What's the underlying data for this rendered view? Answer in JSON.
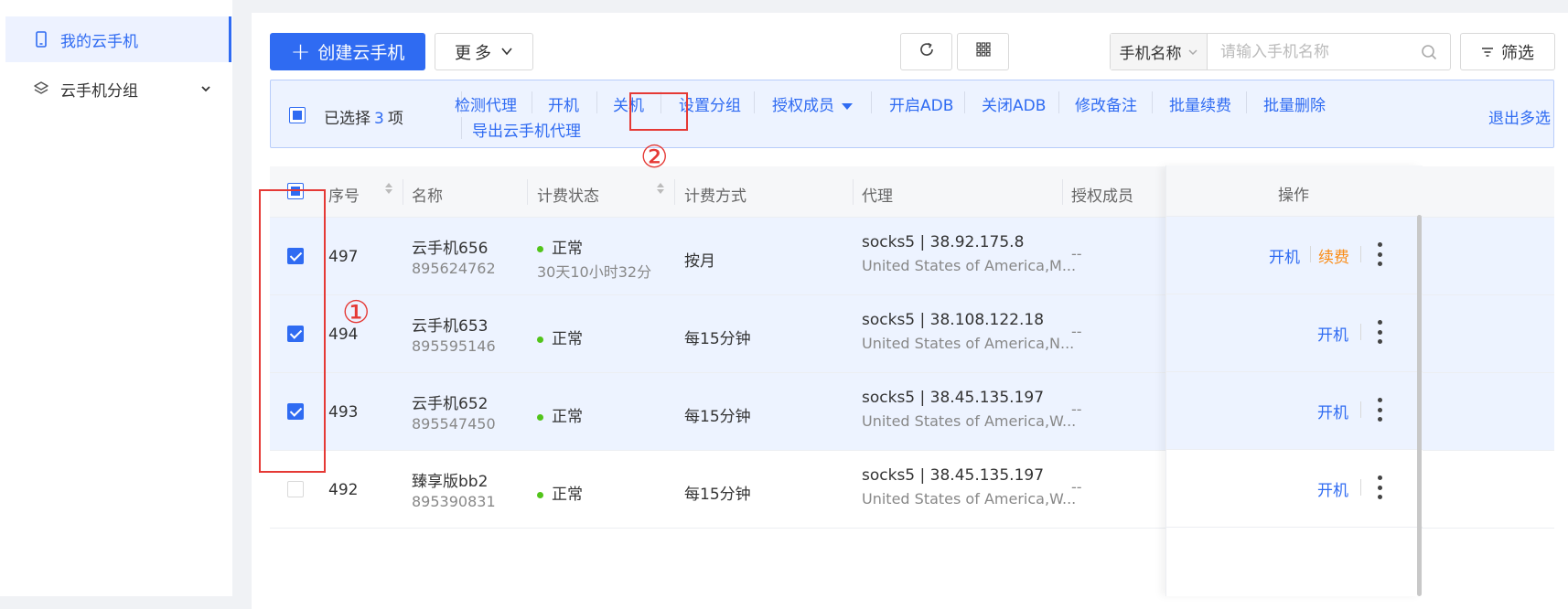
{
  "sidebar": {
    "items": [
      {
        "label": "我的云手机",
        "icon": "phone-icon"
      },
      {
        "label": "云手机分组",
        "icon": "layers-icon"
      }
    ]
  },
  "toolbar": {
    "create_label": "创建云手机",
    "more_label": "更多",
    "search_select": "手机名称",
    "search_placeholder": "请输入手机名称",
    "filter_label": "筛选"
  },
  "selection_bar": {
    "prefix": "已选择",
    "count": "3",
    "suffix": "项",
    "actions": [
      "检测代理",
      "开机",
      "关机",
      "设置分组",
      "授权成员",
      "开启ADB",
      "关闭ADB",
      "修改备注",
      "批量续费",
      "批量删除"
    ],
    "second_row_action": "导出云手机代理",
    "exit_label": "退出多选"
  },
  "annotations": {
    "circle1": "①",
    "circle2": "②"
  },
  "table": {
    "headers": [
      "序号",
      "名称",
      "计费状态",
      "计费方式",
      "代理",
      "授权成员",
      "操作"
    ],
    "rows": [
      {
        "id": "497",
        "name": "云手机656",
        "code": "895624762",
        "status": "正常",
        "status_sub": "30天10小时32分",
        "billing": "按月",
        "proxy": "socks5 | 38.92.175.8",
        "proxy_loc": "United States of America,M...",
        "members": "--",
        "op1": "开机",
        "op2": "续费",
        "selected": true
      },
      {
        "id": "494",
        "name": "云手机653",
        "code": "895595146",
        "status": "正常",
        "status_sub": "",
        "billing": "每15分钟",
        "proxy": "socks5 | 38.108.122.18",
        "proxy_loc": "United States of America,N...",
        "members": "--",
        "op1": "开机",
        "op2": "",
        "selected": true
      },
      {
        "id": "493",
        "name": "云手机652",
        "code": "895547450",
        "status": "正常",
        "status_sub": "",
        "billing": "每15分钟",
        "proxy": "socks5 | 38.45.135.197",
        "proxy_loc": "United States of America,W...",
        "members": "--",
        "op1": "开机",
        "op2": "",
        "selected": true
      },
      {
        "id": "492",
        "name": "臻享版bb2",
        "code": "895390831",
        "status": "正常",
        "status_sub": "",
        "billing": "每15分钟",
        "proxy": "socks5 | 38.45.135.197",
        "proxy_loc": "United States of America,W...",
        "members": "--",
        "op1": "开机",
        "op2": "",
        "selected": false
      }
    ]
  },
  "colors": {
    "accent": "#2f6bf2",
    "renew": "#fa8c16",
    "status_ok": "#52c41a",
    "annotation": "#e53935"
  }
}
